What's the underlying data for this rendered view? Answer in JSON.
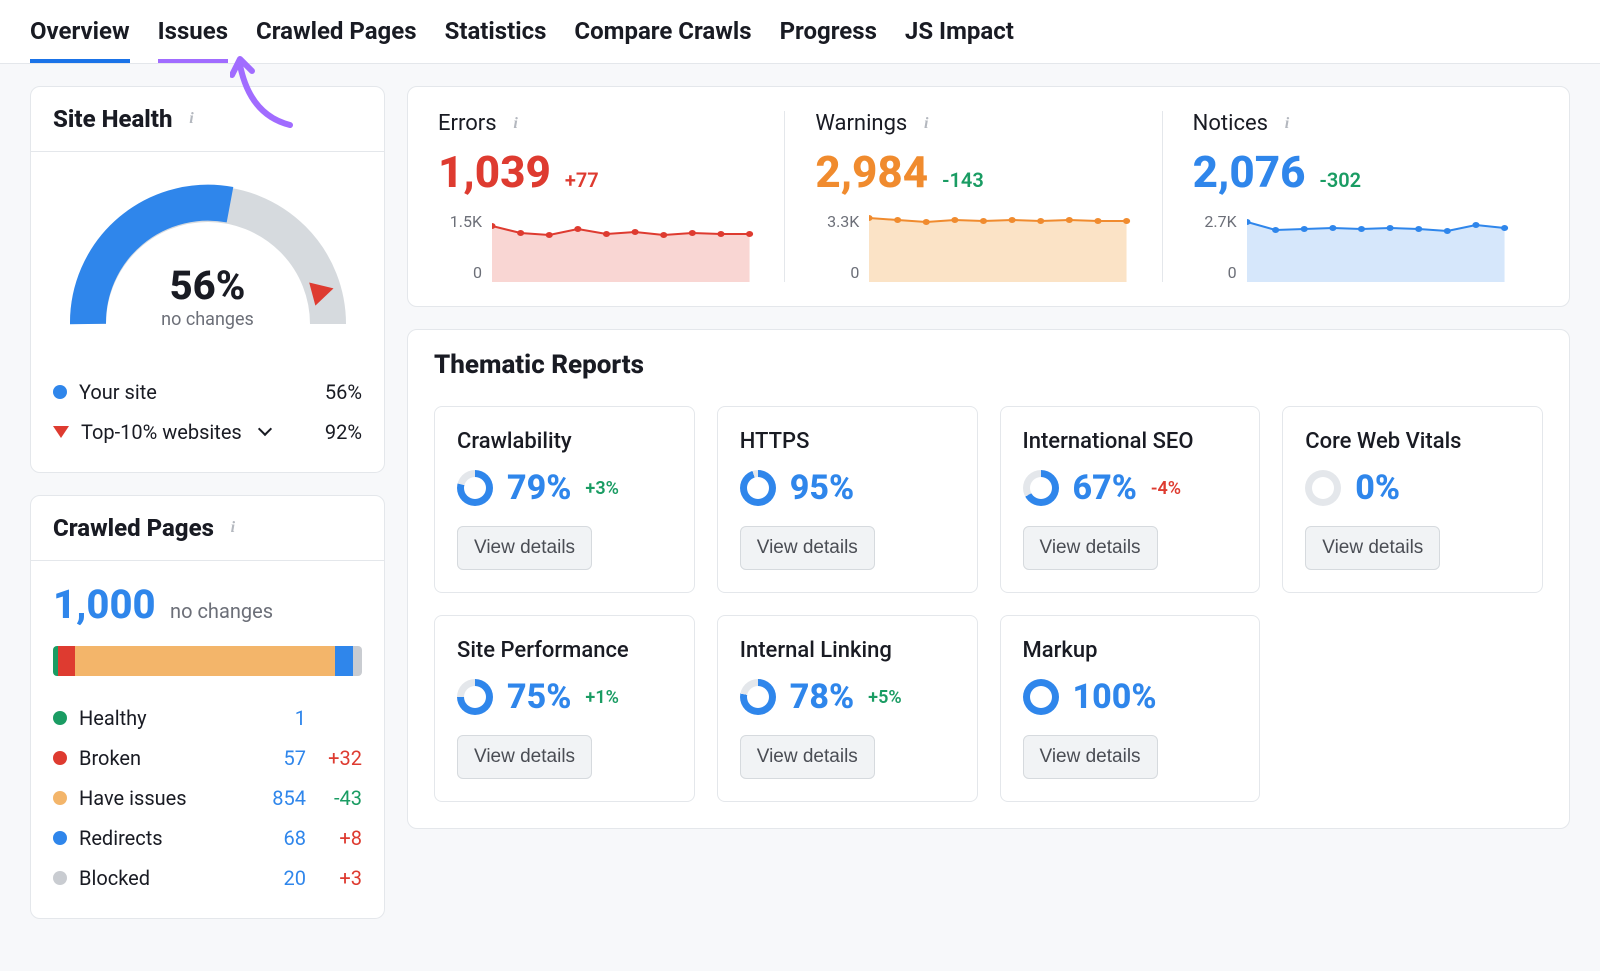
{
  "tabs": {
    "overview": "Overview",
    "issues": "Issues",
    "crawled": "Crawled Pages",
    "statistics": "Statistics",
    "compare": "Compare Crawls",
    "progress": "Progress",
    "jsimpact": "JS Impact"
  },
  "site_health": {
    "title": "Site Health",
    "percent": "56%",
    "sub": "no changes",
    "legend": {
      "your_site_label": "Your site",
      "your_site_value": "56%",
      "top10_label": "Top-10% websites",
      "top10_value": "92%"
    }
  },
  "crawled_pages": {
    "title": "Crawled Pages",
    "count": "1,000",
    "sub": "no changes",
    "breakdown": {
      "healthy": {
        "label": "Healthy",
        "count": "1",
        "delta": ""
      },
      "broken": {
        "label": "Broken",
        "count": "57",
        "delta": "+32"
      },
      "have_issues": {
        "label": "Have issues",
        "count": "854",
        "delta": "-43"
      },
      "redirects": {
        "label": "Redirects",
        "count": "68",
        "delta": "+8"
      },
      "blocked": {
        "label": "Blocked",
        "count": "20",
        "delta": "+3"
      }
    }
  },
  "metrics": {
    "errors": {
      "title": "Errors",
      "value": "1,039",
      "delta": "+77",
      "ymax": "1.5K",
      "ymin": "0"
    },
    "warnings": {
      "title": "Warnings",
      "value": "2,984",
      "delta": "-143",
      "ymax": "3.3K",
      "ymin": "0"
    },
    "notices": {
      "title": "Notices",
      "value": "2,076",
      "delta": "-302",
      "ymax": "2.7K",
      "ymin": "0"
    }
  },
  "thematic": {
    "title": "Thematic Reports",
    "view_label": "View details",
    "reports": {
      "crawl": {
        "title": "Crawlability",
        "pct": "79%",
        "delta": "+3%"
      },
      "https": {
        "title": "HTTPS",
        "pct": "95%",
        "delta": ""
      },
      "intl": {
        "title": "International SEO",
        "pct": "67%",
        "delta": "-4%"
      },
      "cwv": {
        "title": "Core Web Vitals",
        "pct": "0%",
        "delta": ""
      },
      "perf": {
        "title": "Site Performance",
        "pct": "75%",
        "delta": "+1%"
      },
      "linking": {
        "title": "Internal Linking",
        "pct": "78%",
        "delta": "+5%"
      },
      "markup": {
        "title": "Markup",
        "pct": "100%",
        "delta": ""
      }
    }
  },
  "chart_data": [
    {
      "type": "line",
      "title": "Errors",
      "ylim": [
        0,
        1500
      ],
      "y": [
        1200,
        1050,
        1020,
        1150,
        1040,
        1080,
        1030,
        1060,
        1040,
        1039
      ]
    },
    {
      "type": "line",
      "title": "Warnings",
      "ylim": [
        0,
        3300
      ],
      "y": [
        3100,
        3000,
        2950,
        3050,
        2980,
        3020,
        2990,
        3030,
        3000,
        2984
      ]
    },
    {
      "type": "line",
      "title": "Notices",
      "ylim": [
        0,
        2700
      ],
      "y": [
        2300,
        2000,
        2050,
        2080,
        2040,
        2100,
        2060,
        1980,
        2200,
        2076
      ]
    },
    {
      "type": "bar",
      "title": "Crawled Pages breakdown",
      "categories": [
        "Healthy",
        "Broken",
        "Have issues",
        "Redirects",
        "Blocked"
      ],
      "values": [
        1,
        57,
        854,
        68,
        20
      ]
    },
    {
      "type": "pie",
      "title": "Site Health gauge",
      "categories": [
        "Your site",
        "Remaining"
      ],
      "values": [
        56,
        44
      ]
    }
  ]
}
